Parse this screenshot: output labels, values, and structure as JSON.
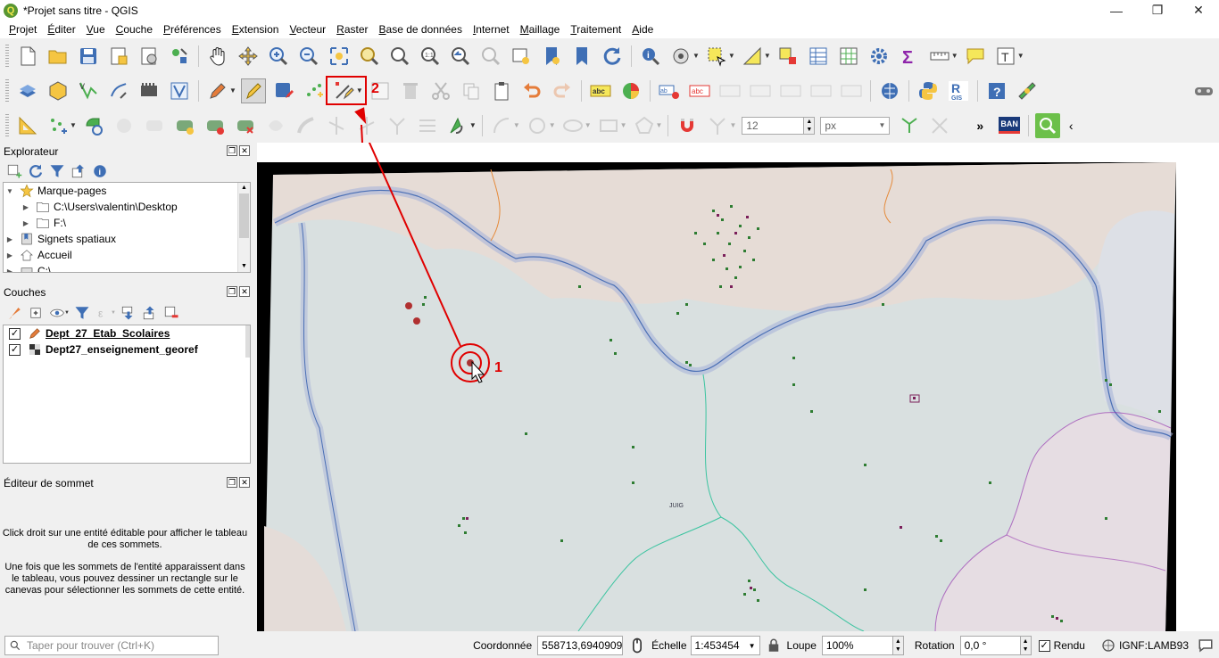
{
  "window": {
    "title": "*Projet sans titre - QGIS"
  },
  "menu": [
    "Projet",
    "Éditer",
    "Vue",
    "Couche",
    "Préférences",
    "Extension",
    "Vecteur",
    "Raster",
    "Base de données",
    "Internet",
    "Maillage",
    "Traitement",
    "Aide"
  ],
  "toolbar3": {
    "snap_tolerance": "12",
    "snap_unit": "px",
    "ban_label": "BAN",
    "more": "»"
  },
  "explorer": {
    "title": "Explorateur",
    "items": [
      {
        "label": "Marque-pages",
        "level": 0,
        "icon": "star-icon"
      },
      {
        "label": "C:\\Users\\valentin\\Desktop",
        "level": 1,
        "icon": "folder-icon"
      },
      {
        "label": "F:\\",
        "level": 1,
        "icon": "folder-icon"
      },
      {
        "label": "Signets spatiaux",
        "level": 0,
        "icon": "bookmark-icon"
      },
      {
        "label": "Accueil",
        "level": 0,
        "icon": "home-icon"
      },
      {
        "label": "C:\\",
        "level": 0,
        "icon": "drive-icon"
      }
    ]
  },
  "layers": {
    "title": "Couches",
    "items": [
      {
        "label": "Dept_27_Etab_Scolaires",
        "checked": true,
        "bold_underline": true
      },
      {
        "label": "Dept27_enseignement_georef",
        "checked": true,
        "bold_underline": false
      }
    ]
  },
  "vertex_editor": {
    "title": "Éditeur de sommet",
    "text1": "Click droit sur une entité éditable pour afficher le tableau de ces sommets.",
    "text2": "Une fois que les sommets de l'entité apparaissent dans le tableau, vous pouvez dessiner un rectangle sur le canevas pour sélectionner les sommets de cette entité."
  },
  "annotations": {
    "label1": "1",
    "label2": "2",
    "color": "#e00000"
  },
  "map": {
    "label": "JUIG"
  },
  "statusbar": {
    "search_placeholder": "Taper pour trouver (Ctrl+K)",
    "coord_label": "Coordonnée",
    "coord_value": "558713,6940909",
    "scale_label": "Échelle",
    "scale_value": "1:453454",
    "zoom_label": "Loupe",
    "zoom_value": "100%",
    "rotation_label": "Rotation",
    "rotation_value": "0,0 °",
    "render_label": "Rendu",
    "crs": "IGNF:LAMB93"
  }
}
